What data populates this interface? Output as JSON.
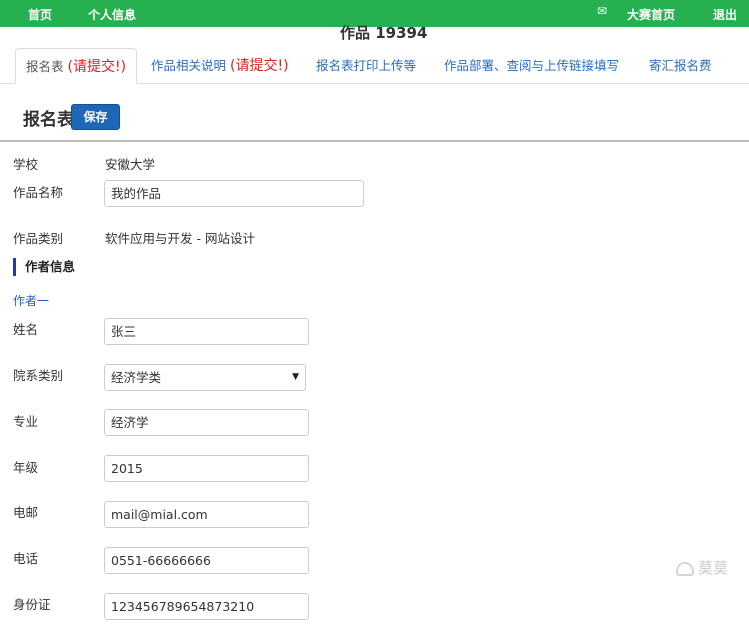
{
  "nav": {
    "home": "首页",
    "profile": "个人信息",
    "mail_icon": "✉",
    "contest_home": "大赛首页",
    "logout": "退出"
  },
  "work_title": "作品 19394",
  "tabs": [
    {
      "label": "报名表",
      "required": "(请提交!)"
    },
    {
      "label": "作品相关说明",
      "required": "(请提交!)"
    },
    {
      "label": "报名表打印上传等",
      "required": ""
    },
    {
      "label": "作品部署、查阅与上传链接填写",
      "required": ""
    },
    {
      "label": "寄汇报名费",
      "required": ""
    }
  ],
  "section": {
    "title": "报名表",
    "save_label": "保存"
  },
  "form": {
    "school_label": "学校",
    "school_value": "安徽大学",
    "work_name_label": "作品名称",
    "work_name_value": "我的作品",
    "category_label": "作品类别",
    "category_value": "软件应用与开发 - 网站设计"
  },
  "author_info_title": "作者信息",
  "author_one_title": "作者一",
  "author": {
    "name_label": "姓名",
    "name_value": "张三",
    "dept_label": "院系类别",
    "dept_value": "经济学类",
    "major_label": "专业",
    "major_value": "经济学",
    "grade_label": "年级",
    "grade_value": "2015",
    "email_label": "电邮",
    "email_value": "mail@mial.com",
    "phone_label": "电话",
    "phone_value": "0551-66666666",
    "id_label": "身份证",
    "id_value": "123456789654873210"
  },
  "watermark": "莫莫"
}
